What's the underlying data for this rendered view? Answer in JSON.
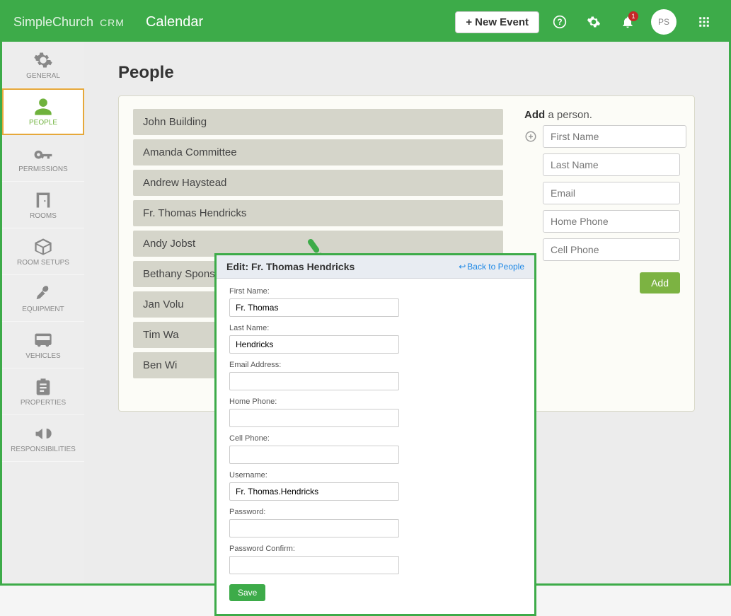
{
  "topbar": {
    "brand_main": "SimpleChurch",
    "brand_sub": "CRM",
    "page_name": "Calendar",
    "new_event_label": "New Event",
    "notification_count": "1",
    "avatar_initials": "PS"
  },
  "sidebar": {
    "items": [
      {
        "label": "GENERAL",
        "icon": "gear"
      },
      {
        "label": "PEOPLE",
        "icon": "person",
        "active": true
      },
      {
        "label": "PERMISSIONS",
        "icon": "key"
      },
      {
        "label": "ROOMS",
        "icon": "door"
      },
      {
        "label": "ROOM SETUPS",
        "icon": "box"
      },
      {
        "label": "EQUIPMENT",
        "icon": "mic"
      },
      {
        "label": "VEHICLES",
        "icon": "bus"
      },
      {
        "label": "PROPERTIES",
        "icon": "clipboard"
      },
      {
        "label": "RESPONSIBILITIES",
        "icon": "megaphone"
      }
    ]
  },
  "page": {
    "heading": "People"
  },
  "people_list": [
    "John Building",
    "Amanda Committee",
    "Andrew Haystead",
    "Fr. Thomas Hendricks",
    "Andy Jobst",
    "Bethany Sponseller",
    "Jan Volu",
    "Tim Wa",
    "Ben Wi"
  ],
  "add_panel": {
    "label_add": "Add",
    "label_rest": " a person.",
    "placeholders": {
      "first_name": "First Name",
      "last_name": "Last Name",
      "email": "Email",
      "home_phone": "Home Phone",
      "cell_phone": "Cell Phone"
    },
    "add_button": "Add"
  },
  "modal": {
    "title": "Edit: Fr. Thomas Hendricks",
    "back_link": "Back to People",
    "fields": {
      "first_name": {
        "label": "First Name:",
        "value": "Fr. Thomas"
      },
      "last_name": {
        "label": "Last Name:",
        "value": "Hendricks"
      },
      "email": {
        "label": "Email Address:",
        "value": ""
      },
      "home_phone": {
        "label": "Home Phone:",
        "value": ""
      },
      "cell_phone": {
        "label": "Cell Phone:",
        "value": ""
      },
      "username": {
        "label": "Username:",
        "value": "Fr. Thomas.Hendricks"
      },
      "password": {
        "label": "Password:",
        "value": ""
      },
      "password_confirm": {
        "label": "Password Confirm:",
        "value": ""
      }
    },
    "save_button": "Save"
  }
}
